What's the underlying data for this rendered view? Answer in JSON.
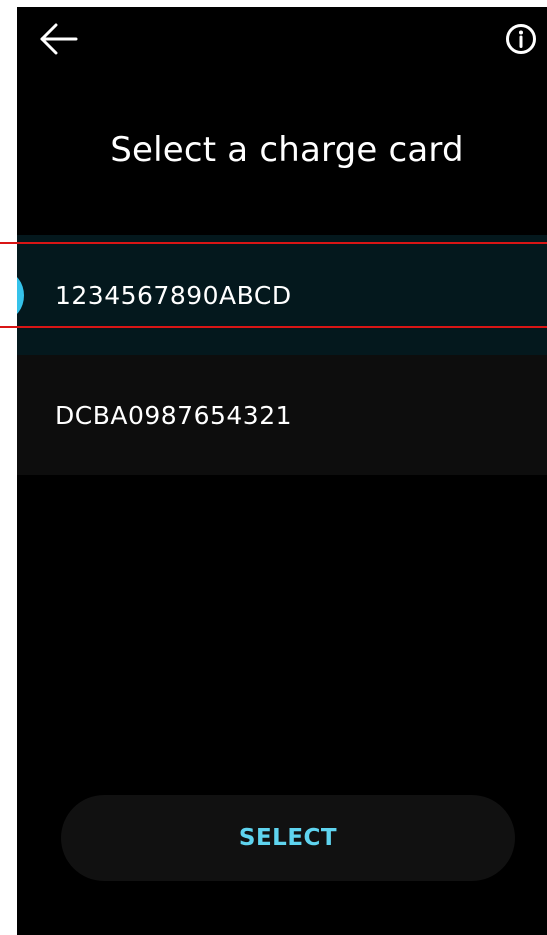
{
  "header": {
    "title": "Select a charge card",
    "back_icon": "arrow-left-icon",
    "info_icon": "info-circle-icon"
  },
  "cards": [
    {
      "label": "1234567890ABCD",
      "selected": true
    },
    {
      "label": "DCBA0987654321",
      "selected": false
    }
  ],
  "actions": {
    "select_label": "SELECT"
  },
  "colors": {
    "background": "#000000",
    "selected_row": "#04181d",
    "unselected_row": "#0d0d0d",
    "accent": "#35c2ea",
    "button_text": "#5fd4ef",
    "highlight": "#d91515"
  }
}
